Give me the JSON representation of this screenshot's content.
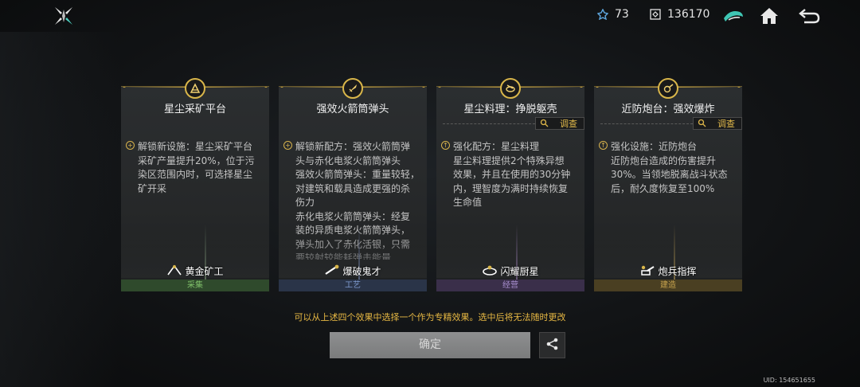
{
  "topbar": {
    "energy_value": "73",
    "credits_value": "136170",
    "icons": [
      "logo-icon",
      "energy-icon",
      "credits-icon",
      "faction-icon",
      "home-icon",
      "back-icon"
    ]
  },
  "cards": [
    {
      "title": "星尘采矿平台",
      "has_investigate": false,
      "effect_icon": "+",
      "effect_text": "解锁新设施：星尘采矿平台\n采矿产量提升20%，位于污\n染区范围内时，可选择星尘\n矿开采",
      "talent": "黄金矿工",
      "category": "采集",
      "category_color": "#2f4a2c",
      "category_text_color": "#7fbf6a"
    },
    {
      "title": "强效火箭筒弹头",
      "has_investigate": false,
      "effect_icon": "+",
      "effect_text": "解锁新配方：强效火箭筒弹\n头与赤化电浆火箭筒弹头\n强效火箭筒弹头：重量较轻，\n对建筑和载具造成更强的杀\n伤力\n赤化电浆火箭筒弹头：经复\n装的异质电浆火箭筒弹头，\n弹头加入了赤化活银，只需\n要较射较能耗弹击能量",
      "talent": "爆破鬼才",
      "category": "工艺",
      "category_color": "#2a3448",
      "category_text_color": "#7f9bd0"
    },
    {
      "title": "星尘料理：挣脱躯壳",
      "has_investigate": true,
      "investigate_label": "调查",
      "effect_icon": "↑",
      "effect_text": "强化配方：星尘料理\n星尘料理提供2个特殊异想\n效果，并且在使用的30分钟\n内，理智度为满时持续恢复\n生命值",
      "talent": "闪耀厨星",
      "category": "经营",
      "category_color": "#3a2f4a",
      "category_text_color": "#a98fd0"
    },
    {
      "title": "近防炮台：强效爆炸",
      "has_investigate": true,
      "investigate_label": "调查",
      "effect_icon": "↑",
      "effect_text": "强化设施：近防炮台\n近防炮台造成的伤害提升\n30%。当领地脱离战斗状态\n后，耐久度恢复至100%",
      "talent": "炮兵指挥",
      "category": "建造",
      "category_color": "#4a3f22",
      "category_text_color": "#c9a44e"
    }
  ],
  "notice": "可以从上述四个效果中选择一个作为专精效果。选中后将无法随时更改",
  "confirm_label": "确定",
  "uid": "UID: 154651655",
  "colors": {
    "gold": "#e7b843",
    "card_bg": "#2b2e30"
  }
}
